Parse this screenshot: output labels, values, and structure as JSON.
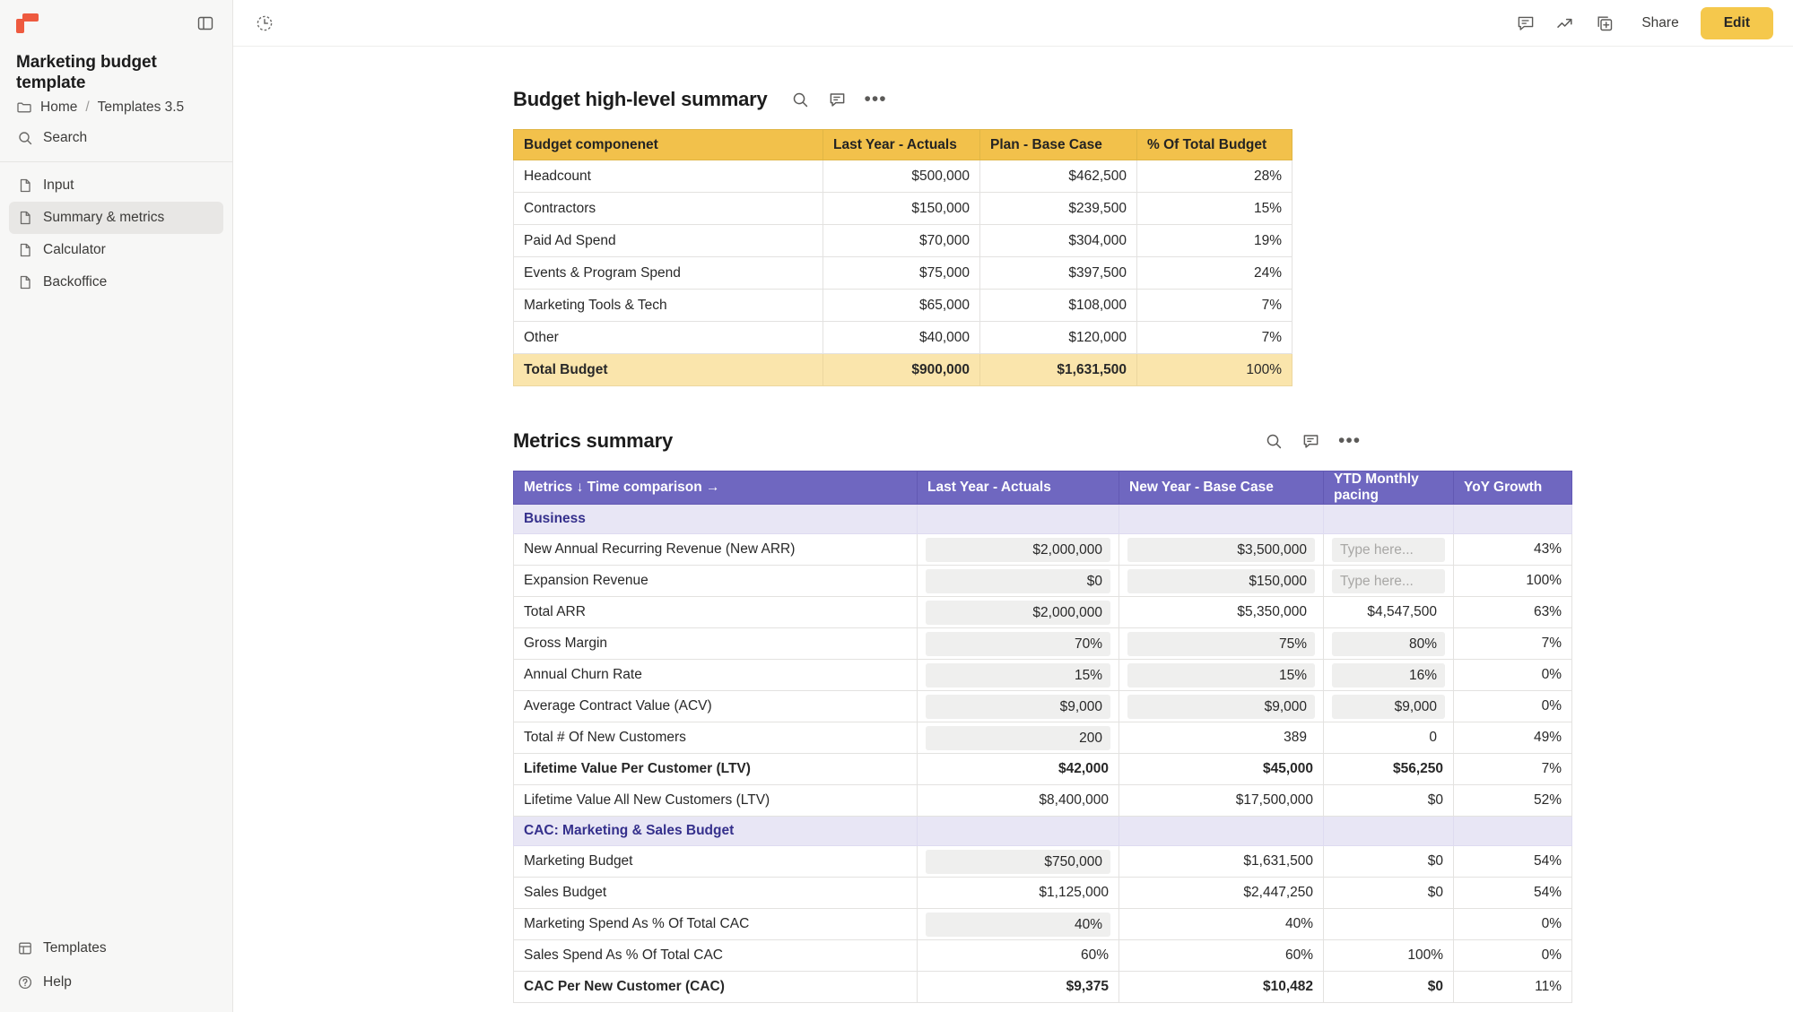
{
  "app": {
    "logo_icon": "coda-logo-icon",
    "collapse_panel_icon": "panel-toggle-icon"
  },
  "sidebar": {
    "doc_title": "Marketing budget template",
    "breadcrumb": {
      "folder_icon": "folder-icon",
      "home": "Home",
      "separator": "/",
      "space": "Templates 3.5"
    },
    "search": {
      "icon": "search-icon",
      "label": "Search"
    },
    "pages": [
      {
        "icon": "page-icon",
        "label": "Input",
        "active": false
      },
      {
        "icon": "page-icon",
        "label": "Summary & metrics",
        "active": true
      },
      {
        "icon": "page-icon",
        "label": "Calculator",
        "active": false
      },
      {
        "icon": "page-icon",
        "label": "Backoffice",
        "active": false
      }
    ],
    "bottom": [
      {
        "icon": "templates-icon",
        "label": "Templates"
      },
      {
        "icon": "help-icon",
        "label": "Help"
      }
    ]
  },
  "topbar": {
    "history_icon": "history-clock-icon",
    "comment_icon": "comment-icon",
    "insights_icon": "trending-up-icon",
    "copy_icon": "add-to-doc-icon",
    "share_label": "Share",
    "edit_label": "Edit"
  },
  "budget_summary": {
    "title": "Budget high-level summary",
    "actions": {
      "search_icon": "search-icon",
      "comment_icon": "comment-icon",
      "more_icon": "more-options-icon"
    },
    "columns": [
      "Budget componenet",
      "Last Year - Actuals",
      "Plan - Base Case",
      "% Of Total Budget"
    ],
    "rows": [
      {
        "component": "Headcount",
        "last_year": "$500,000",
        "plan": "$462,500",
        "pct": "28%"
      },
      {
        "component": "Contractors",
        "last_year": "$150,000",
        "plan": "$239,500",
        "pct": "15%"
      },
      {
        "component": "Paid Ad Spend",
        "last_year": "$70,000",
        "plan": "$304,000",
        "pct": "19%"
      },
      {
        "component": "Events & Program Spend",
        "last_year": "$75,000",
        "plan": "$397,500",
        "pct": "24%"
      },
      {
        "component": "Marketing Tools & Tech",
        "last_year": "$65,000",
        "plan": "$108,000",
        "pct": "7%"
      },
      {
        "component": "Other",
        "last_year": "$40,000",
        "plan": "$120,000",
        "pct": "7%"
      }
    ],
    "total": {
      "component": "Total Budget",
      "last_year": "$900,000",
      "plan": "$1,631,500",
      "pct": "100%"
    }
  },
  "metrics_summary": {
    "title": "Metrics summary",
    "actions": {
      "search_icon": "search-icon",
      "comment_icon": "comment-icon",
      "more_icon": "more-options-icon"
    },
    "columns": [
      "Metrics ↓ Time comparison →",
      "Last Year - Actuals",
      "New Year - Base Case",
      "YTD Monthly pacing",
      "YoY Growth"
    ],
    "placeholder": "Type here...",
    "sections": [
      {
        "name": "Business",
        "rows": [
          {
            "metric": "New Annual Recurring Revenue (New ARR)",
            "last_year": "$2,000,000",
            "new_year": "$3,500,000",
            "ytd": "",
            "ytd_placeholder": true,
            "yoy": "43%",
            "bold": false
          },
          {
            "metric": "Expansion Revenue",
            "last_year": "$0",
            "new_year": "$150,000",
            "ytd": "",
            "ytd_placeholder": true,
            "yoy": "100%",
            "bold": false
          },
          {
            "metric": "Total ARR",
            "last_year": "$2,000,000",
            "new_year": "$5,350,000",
            "ytd": "$4,547,500",
            "yoy": "63%",
            "bold": false
          },
          {
            "metric": "Gross Margin",
            "last_year": "70%",
            "new_year": "75%",
            "ytd": "80%",
            "yoy": "7%",
            "bold": false
          },
          {
            "metric": "Annual Churn Rate",
            "last_year": "15%",
            "new_year": "15%",
            "ytd": "16%",
            "yoy": "0%",
            "bold": false
          },
          {
            "metric": "Average Contract Value (ACV)",
            "last_year": "$9,000",
            "new_year": "$9,000",
            "ytd": "$9,000",
            "yoy": "0%",
            "bold": false
          },
          {
            "metric": "Total # Of New Customers",
            "last_year": "200",
            "new_year": "389",
            "ytd": "0",
            "yoy": "49%",
            "bold": false
          },
          {
            "metric": "Lifetime Value Per Customer (LTV)",
            "last_year": "$42,000",
            "new_year": "$45,000",
            "ytd": "$56,250",
            "yoy": "7%",
            "bold": true
          },
          {
            "metric": "Lifetime Value All New Customers (LTV)",
            "last_year": "$8,400,000",
            "new_year": "$17,500,000",
            "ytd": "$0",
            "yoy": "52%",
            "bold": false
          }
        ]
      },
      {
        "name": "CAC: Marketing & Sales Budget",
        "rows": [
          {
            "metric": "Marketing Budget",
            "last_year": "$750,000",
            "new_year": "$1,631,500",
            "ytd": "$0",
            "yoy": "54%",
            "bold": false
          },
          {
            "metric": "Sales Budget",
            "last_year": "$1,125,000",
            "new_year": "$2,447,250",
            "ytd": "$0",
            "yoy": "54%",
            "bold": false
          },
          {
            "metric": "Marketing Spend As % Of Total CAC",
            "last_year": "40%",
            "new_year": "40%",
            "ytd": "",
            "yoy": "0%",
            "bold": false
          },
          {
            "metric": "Sales Spend As % Of Total CAC",
            "last_year": "60%",
            "new_year": "60%",
            "ytd": "100%",
            "yoy": "0%",
            "bold": false
          },
          {
            "metric": "CAC Per New Customer (CAC)",
            "last_year": "$9,375",
            "new_year": "$10,482",
            "ytd": "$0",
            "yoy": "11%",
            "bold": true
          }
        ]
      }
    ]
  }
}
